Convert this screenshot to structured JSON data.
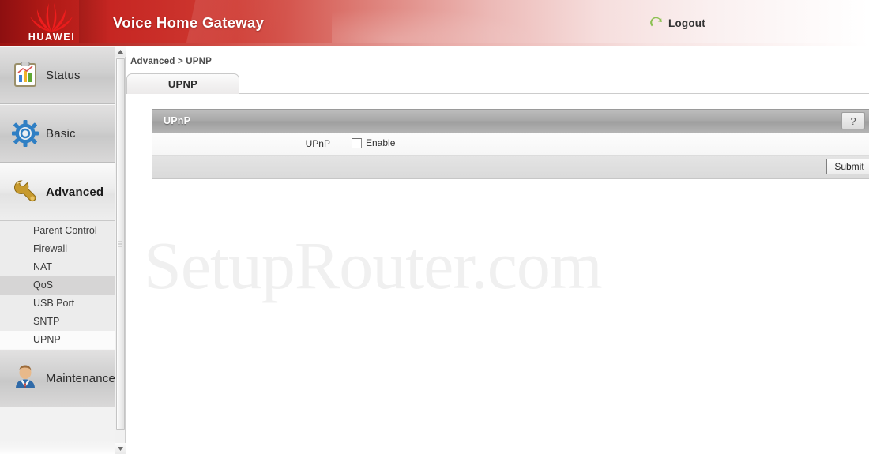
{
  "header": {
    "brand_word": "HUAWEI",
    "title": "Voice Home Gateway",
    "logout_label": "Logout",
    "logout_icon": "refresh-back-arrow-icon",
    "brand_red": "#c62622",
    "logout_icon_color": "#8cc152"
  },
  "sidebar": {
    "groups": [
      {
        "label": "Status",
        "icon": "chart-clipboard-icon",
        "active": false
      },
      {
        "label": "Basic",
        "icon": "blue-gear-icon",
        "active": false
      },
      {
        "label": "Advanced",
        "icon": "wrench-icon",
        "active": true
      },
      {
        "label": "Maintenance",
        "icon": "user-person-icon",
        "active": false
      }
    ],
    "submenu": [
      {
        "label": "Parent Control",
        "state": "normal"
      },
      {
        "label": "Firewall",
        "state": "normal"
      },
      {
        "label": "NAT",
        "state": "normal"
      },
      {
        "label": "QoS",
        "state": "hover"
      },
      {
        "label": "USB Port",
        "state": "normal"
      },
      {
        "label": "SNTP",
        "state": "normal"
      },
      {
        "label": "UPNP",
        "state": "selected"
      }
    ]
  },
  "content": {
    "breadcrumb": "Advanced > UPNP",
    "tab_label": "UPNP",
    "panel": {
      "title": "UPnP",
      "help_label": "?",
      "row_label": "UPnP",
      "checkbox_label": "Enable",
      "checkbox_checked": false,
      "submit_label": "Submit"
    },
    "watermark": "SetupRouter.com"
  },
  "scrollbar": {
    "up_arrow": "caret-up-icon",
    "down_arrow": "caret-down-icon"
  }
}
